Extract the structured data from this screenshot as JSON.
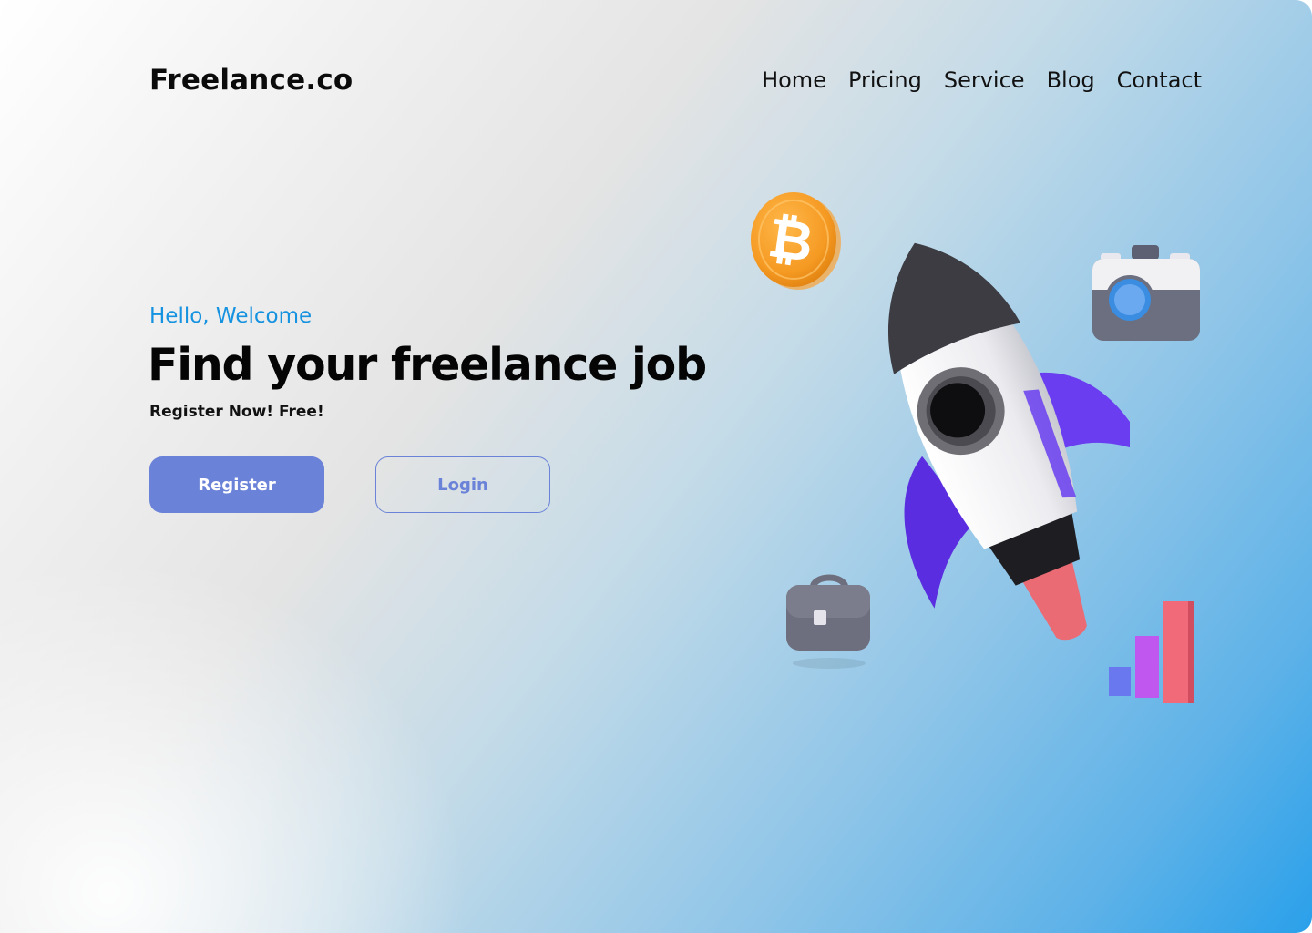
{
  "header": {
    "brand": "Freelance.co",
    "nav": [
      "Home",
      "Pricing",
      "Service",
      "Blog",
      "Contact"
    ]
  },
  "hero": {
    "greeting": "Hello, Welcome",
    "headline": "Find your freelance job",
    "subline": "Register Now! Free!",
    "register_label": "Register",
    "login_label": "Login"
  },
  "illustration": {
    "icons": [
      "bitcoin-coin-icon",
      "rocket-icon",
      "camera-icon",
      "briefcase-icon",
      "bar-chart-icon"
    ]
  },
  "colors": {
    "accent": "#6a82d7",
    "greeting": "#1592e0",
    "gradient_end": "#2aa0ea"
  }
}
